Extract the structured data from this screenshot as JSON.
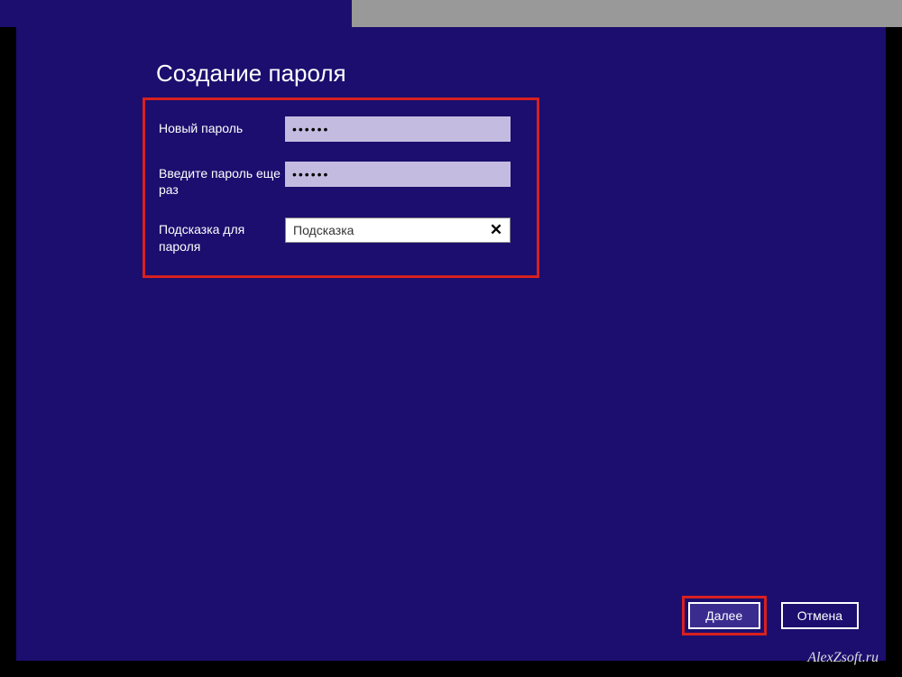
{
  "title": "Создание пароля",
  "fields": {
    "new_password": {
      "label": "Новый пароль",
      "value": "••••••"
    },
    "confirm_password": {
      "label": "Введите пароль еще раз",
      "value": "••••••"
    },
    "hint": {
      "label": "Подсказка для пароля",
      "value": "Подсказка",
      "clear_symbol": "✕"
    }
  },
  "buttons": {
    "next": "Далее",
    "cancel": "Отмена"
  },
  "watermark": "AlexZsoft.ru"
}
